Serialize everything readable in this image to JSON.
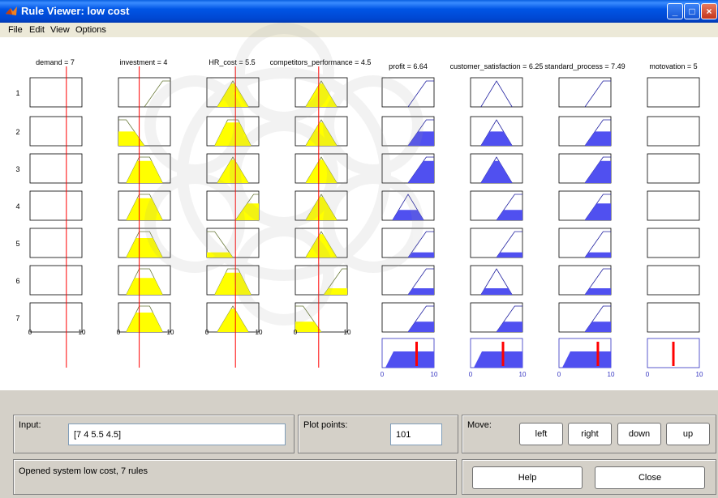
{
  "window": {
    "title": "Rule Viewer: low cost"
  },
  "menu": [
    "File",
    "Edit",
    "View",
    "Options"
  ],
  "inputs": [
    {
      "label": "demand = 7",
      "value": 7
    },
    {
      "label": "investment = 4",
      "value": 4
    },
    {
      "label": "HR_cost = 5.5",
      "value": 5.5
    },
    {
      "label": "competitors_performance = 4.5",
      "value": 4.5
    }
  ],
  "outputs": [
    {
      "label": "profit = 6.64",
      "value": 6.64
    },
    {
      "label": "customer_satisfaction = 6.25",
      "value": 6.25
    },
    {
      "label": "standard_process = 7.49",
      "value": 7.49
    },
    {
      "label": "motovation = 5",
      "value": 5
    }
  ],
  "rows": [
    "1",
    "2",
    "3",
    "4",
    "5",
    "6",
    "7"
  ],
  "axis": {
    "min": "0",
    "max": "10"
  },
  "mf_types": {
    "input": [
      [
        "none",
        "ramp",
        "tri",
        "tri"
      ],
      [
        "none",
        "lowramp",
        "trap",
        "tri"
      ],
      [
        "none",
        "trap",
        "tri",
        "tri"
      ],
      [
        "none",
        "trap",
        "highramp",
        "tri"
      ],
      [
        "none",
        "trap",
        "lowramp",
        "tri"
      ],
      [
        "none",
        "trap",
        "trap",
        "highramp"
      ],
      [
        "none",
        "trap",
        "tri",
        "lowramp"
      ]
    ],
    "output": [
      [
        "ramp",
        "tri",
        "ramp",
        "none"
      ],
      [
        "ramp",
        "tri",
        "ramp",
        "none"
      ],
      [
        "ramp",
        "tri",
        "ramp",
        "none"
      ],
      [
        "tri",
        "ramp",
        "ramp",
        "none"
      ],
      [
        "ramp",
        "ramp",
        "ramp",
        "none"
      ],
      [
        "ramp",
        "tri",
        "ramp",
        "none"
      ],
      [
        "ramp",
        "ramp",
        "ramp",
        "none"
      ]
    ]
  },
  "firing_levels": {
    "input": [
      [
        0,
        0,
        0.9,
        0.9
      ],
      [
        0,
        0.55,
        0.9,
        0.9
      ],
      [
        0,
        0.85,
        0.9,
        0.9
      ],
      [
        0,
        0.85,
        0.65,
        0.9
      ],
      [
        0,
        0.75,
        0.2,
        0.9
      ],
      [
        0,
        0.65,
        0.85,
        0.25
      ],
      [
        0,
        0.75,
        0.9,
        0.4
      ]
    ],
    "output": [
      [
        0,
        0,
        0,
        0
      ],
      [
        0.55,
        0.55,
        0.55,
        0
      ],
      [
        0.85,
        0.85,
        0.85,
        0
      ],
      [
        0.4,
        0.4,
        0.65,
        0
      ],
      [
        0.2,
        0.2,
        0.2,
        0
      ],
      [
        0.25,
        0.25,
        0.25,
        0
      ],
      [
        0.4,
        0.4,
        0.4,
        0
      ]
    ]
  },
  "controls": {
    "input_label": "Input:",
    "input_value": "[7 4 5.5 4.5]",
    "plot_points_label": "Plot points:",
    "plot_points_value": "101",
    "move_label": "Move:",
    "left": "left",
    "right": "right",
    "down": "down",
    "up": "up",
    "help": "Help",
    "close": "Close",
    "status": "Opened system low cost, 7 rules"
  },
  "colors": {
    "input_fill": "#ffff00",
    "output_fill": "#5050f0",
    "result_line": "#ff0000",
    "cursor_line": "#ff0000"
  }
}
